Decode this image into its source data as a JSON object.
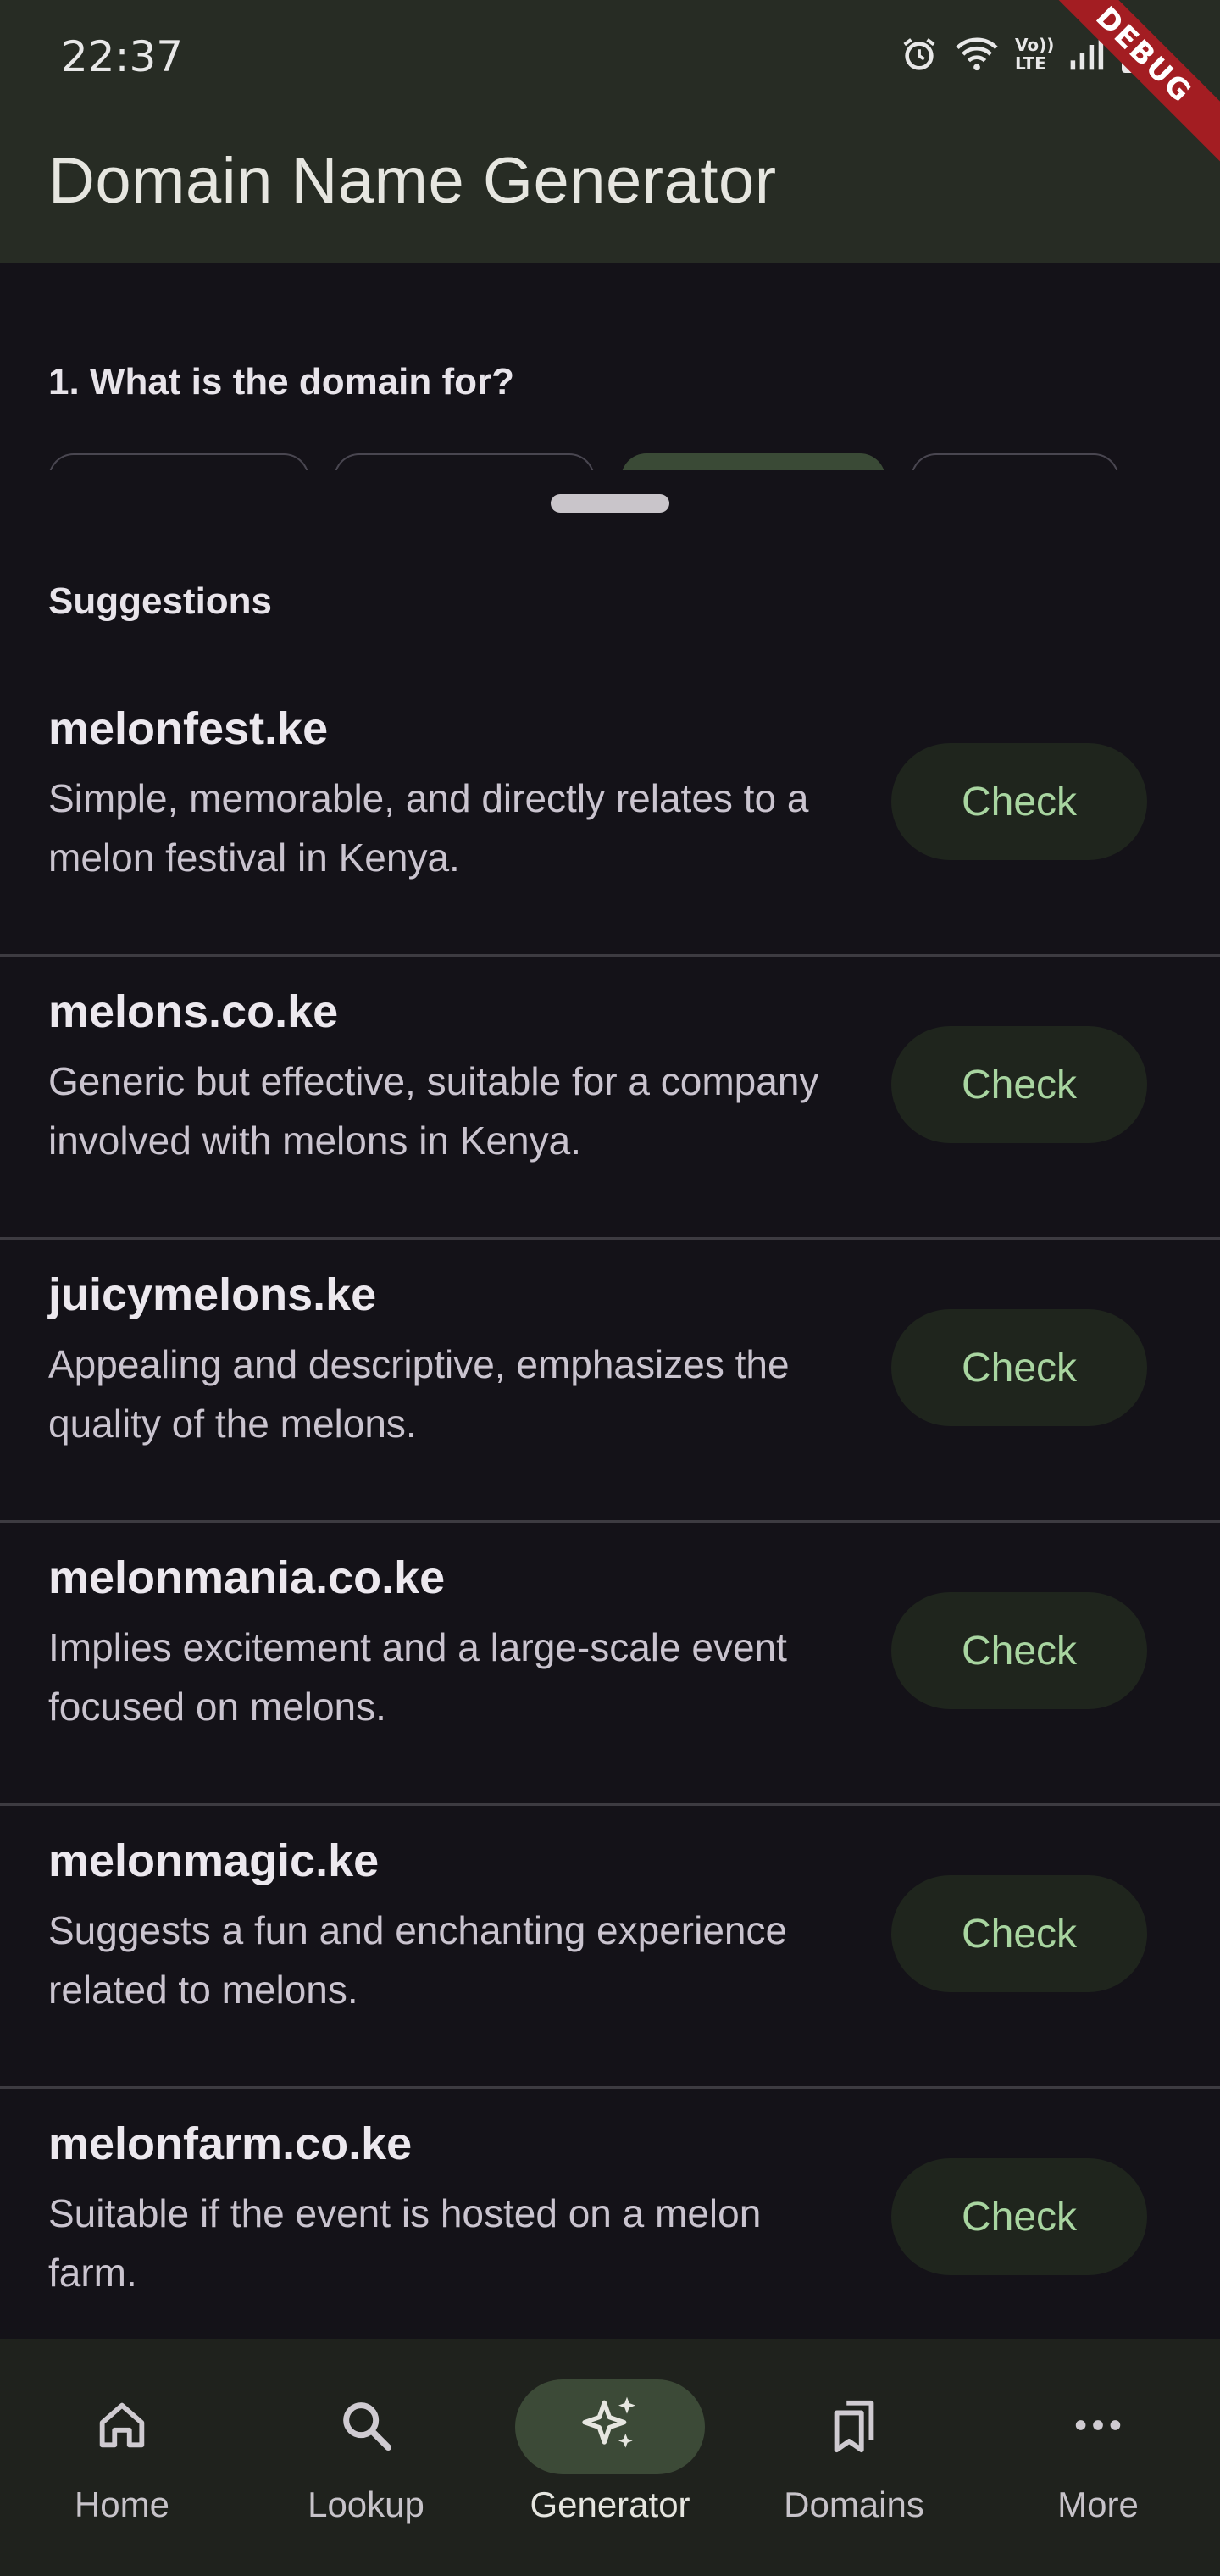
{
  "status_bar": {
    "time": "22:37",
    "icons": [
      "alarm-icon",
      "wifi-icon",
      "volte-icon",
      "signal-icon",
      "battery-icon"
    ],
    "volte_text": "Vo)) LTE"
  },
  "app_bar": {
    "title": "Domain Name Generator"
  },
  "debug_banner": "DEBUG",
  "form": {
    "question": "1. What is the domain for?"
  },
  "sheet": {
    "title": "Suggestions",
    "check_label": "Check",
    "suggestions": [
      {
        "domain": "melonfest.ke",
        "description": "Simple, memorable, and directly relates to a melon festival in Kenya."
      },
      {
        "domain": "melons.co.ke",
        "description": "Generic but effective, suitable for a company involved with melons in Kenya."
      },
      {
        "domain": "juicymelons.ke",
        "description": "Appealing and descriptive, emphasizes the quality of the melons."
      },
      {
        "domain": "melonmania.co.ke",
        "description": "Implies excitement and a large-scale event focused on melons."
      },
      {
        "domain": "melonmagic.ke",
        "description": "Suggests a fun and enchanting experience related to melons."
      },
      {
        "domain": "melonfarm.co.ke",
        "description": "Suitable if the event is hosted on a melon farm."
      }
    ]
  },
  "bottom_nav": {
    "items": [
      {
        "label": "Home",
        "icon": "home-icon"
      },
      {
        "label": "Lookup",
        "icon": "search-icon"
      },
      {
        "label": "Generator",
        "icon": "sparkle-icon",
        "active": true
      },
      {
        "label": "Domains",
        "icon": "bookmarks-icon"
      },
      {
        "label": "More",
        "icon": "more-icon"
      }
    ]
  },
  "colors": {
    "app_bar_bg": "#272c24",
    "surface": "#141218",
    "accent_text": "#a8d5a0",
    "active_nav_pill": "#3c4a37",
    "debug_banner": "#a31d22"
  }
}
